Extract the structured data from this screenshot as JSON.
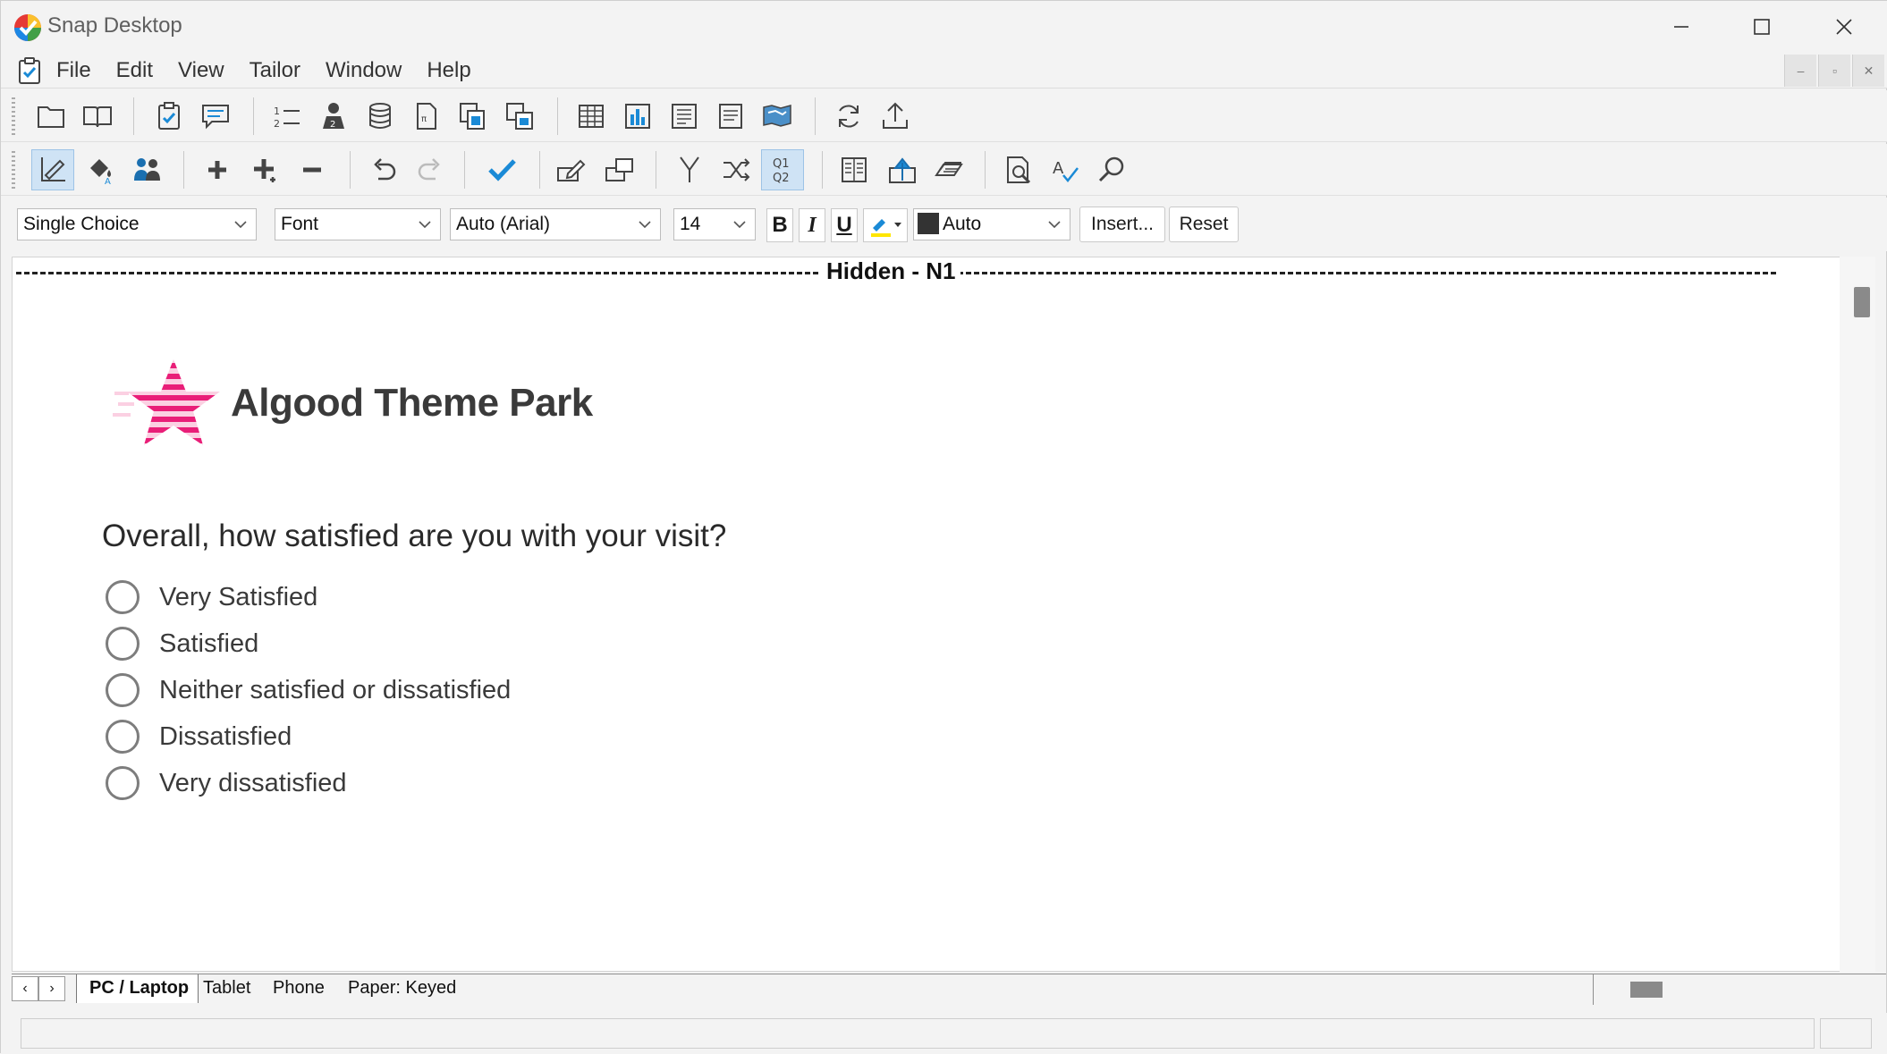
{
  "window": {
    "title": "Snap Desktop"
  },
  "menu": {
    "items": [
      "File",
      "Edit",
      "View",
      "Tailor",
      "Window",
      "Help"
    ]
  },
  "toolbar1": {
    "icons": [
      "new-icon",
      "open-book-icon",
      "questionnaire-icon",
      "comment-icon",
      "numbered-list-icon",
      "respondent-icon",
      "database-icon",
      "document-icon",
      "copy-icon",
      "window-icon",
      "grid-table-icon",
      "bar-chart-icon",
      "report-icon",
      "summary-icon",
      "map-icon",
      "refresh-icon",
      "upload-icon"
    ]
  },
  "toolbar2": {
    "icons": [
      "design-mode-icon",
      "fill-style-icon",
      "people-icon",
      "add-icon",
      "add-many-icon",
      "remove-icon",
      "undo-icon",
      "redo-icon",
      "check-icon",
      "edit-link-icon",
      "route-icon",
      "branch-icon",
      "shuffle-icon",
      "q1q2-icon",
      "page-icon",
      "arrow-up-icon",
      "layers-icon",
      "preview-icon",
      "spell-check-icon",
      "find-icon"
    ],
    "q1q2_label_top": "Q1",
    "q1q2_label_bottom": "Q2"
  },
  "format": {
    "question_type": "Single Choice",
    "font": "Font",
    "font_auto": "Auto (Arial)",
    "size": "14",
    "bold": "B",
    "italic": "I",
    "underline": "U",
    "color": "Auto",
    "insert": "Insert...",
    "reset": "Reset"
  },
  "canvas": {
    "hidden_label": "Hidden - N1",
    "brand": "Algood Theme Park",
    "question": "Overall, how satisfied are you with your visit?",
    "options": [
      "Very Satisfied",
      "Satisfied",
      "Neither satisfied or dissatisfied",
      "Dissatisfied",
      "Very dissatisfied"
    ]
  },
  "tabs": {
    "items": [
      "PC / Laptop",
      "Tablet",
      "Phone",
      "Paper: Keyed"
    ],
    "active": "PC / Laptop",
    "prev": "‹",
    "next": "›"
  },
  "mdi": {
    "minimize": "–",
    "restore": "▫",
    "close": "✕"
  },
  "colors": {
    "accent": "#1e88e5",
    "brand_pink": "#e91e78",
    "check_blue": "#1a8ad6"
  }
}
